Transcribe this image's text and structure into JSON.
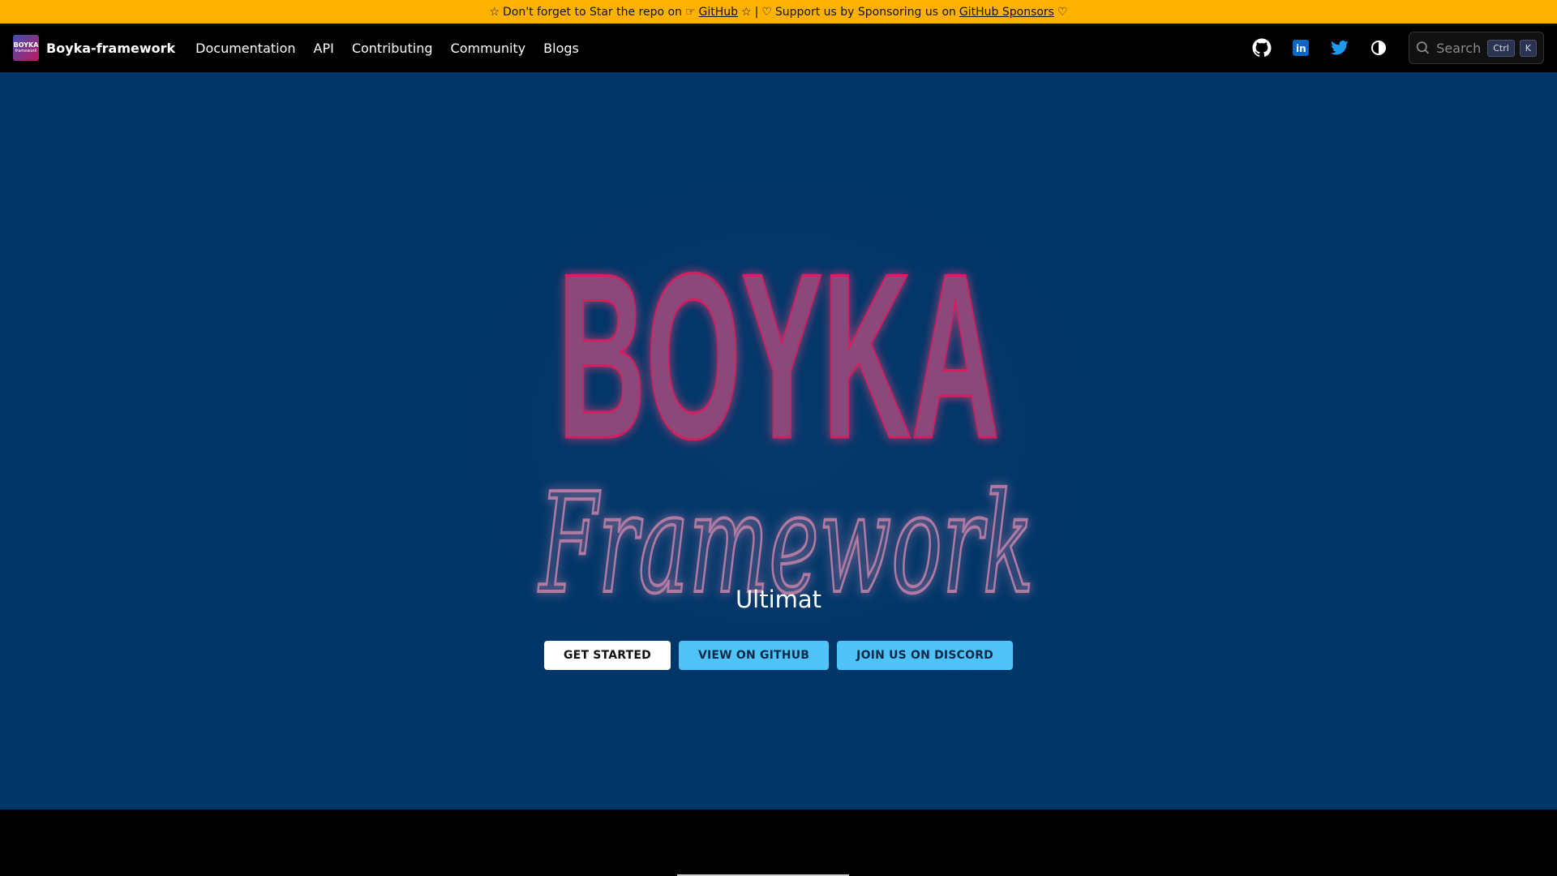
{
  "announcement": {
    "part1": "Don't forget to Star the repo on",
    "github_link": "GitHub",
    "separator": "|",
    "part2": "Support us by Sponsoring us on",
    "sponsors_link": "GitHub Sponsors",
    "star_icon": "star-icon",
    "pointing_icon": "pointing-hand-icon",
    "heart_icon": "heart-icon"
  },
  "navbar": {
    "brand_title": "Boyka-framework",
    "logo_text_top": "BOYKA",
    "logo_text_bottom": "framework",
    "links": [
      "Documentation",
      "API",
      "Contributing",
      "Community",
      "Blogs"
    ],
    "icons": [
      "github-icon",
      "linkedin-icon",
      "twitter-icon",
      "theme-toggle-icon"
    ],
    "search": {
      "placeholder": "Search",
      "kbd_ctrl": "Ctrl",
      "kbd_k": "K"
    }
  },
  "hero": {
    "logo_word_top": "BOYKA",
    "logo_word_bottom": "Framework",
    "tagline": "Ultimat",
    "buttons": {
      "get_started": "GET STARTED",
      "view_github": "VIEW ON GITHUB",
      "discord": "JOIN US ON DISCORD"
    }
  },
  "colors": {
    "announcement_bg": "#ffb300",
    "hero_bg": "#003567",
    "logo_fill": "#8a4a7a",
    "logo_glow": "#d81b60",
    "btn_blue": "#4fc3f7"
  }
}
